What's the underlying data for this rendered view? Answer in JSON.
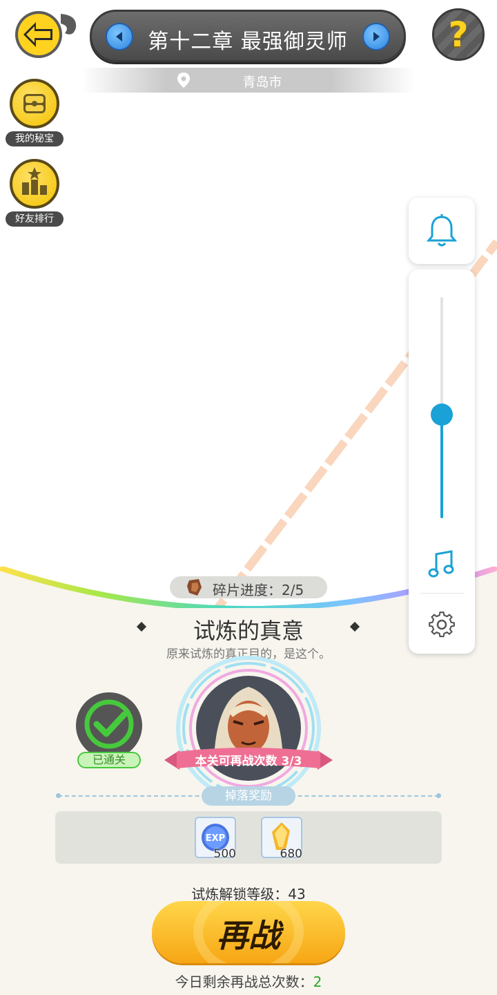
{
  "header": {
    "chapter_title": "第十二章 最强御灵师",
    "location": "青岛市"
  },
  "sidebar": {
    "items": [
      {
        "label": "我的秘宝",
        "icon": "treasure-chest-icon"
      },
      {
        "label": "好友排行",
        "icon": "leaderboard-icon"
      }
    ]
  },
  "volume_panel": {
    "icons": [
      "bell-icon",
      "music-icon",
      "gear-icon"
    ],
    "volume_level": 0.47,
    "accent": "#1aa1d6"
  },
  "stage": {
    "fragment_label": "碎片进度：2/5",
    "title": "试炼的真意",
    "subtitle": "原来试炼的真正目的，是这个。",
    "cleared_label": "已通关",
    "retry_ribbon": "本关可再战次数 3/3",
    "drop_label": "掉落奖励",
    "rewards": [
      {
        "icon": "exp-orb-icon",
        "qty": "500"
      },
      {
        "icon": "gold-crystal-icon",
        "qty": "680"
      }
    ],
    "unlock_label": "试炼解锁等级：43",
    "rebattle_label": "再战",
    "remaining_label": "今日剩余再战总次数：",
    "remaining_count": "2"
  },
  "colors": {
    "button_yellow": "#f7a614",
    "panel_bg": "#f7f5ee",
    "cleared_green": "#46c93c"
  }
}
